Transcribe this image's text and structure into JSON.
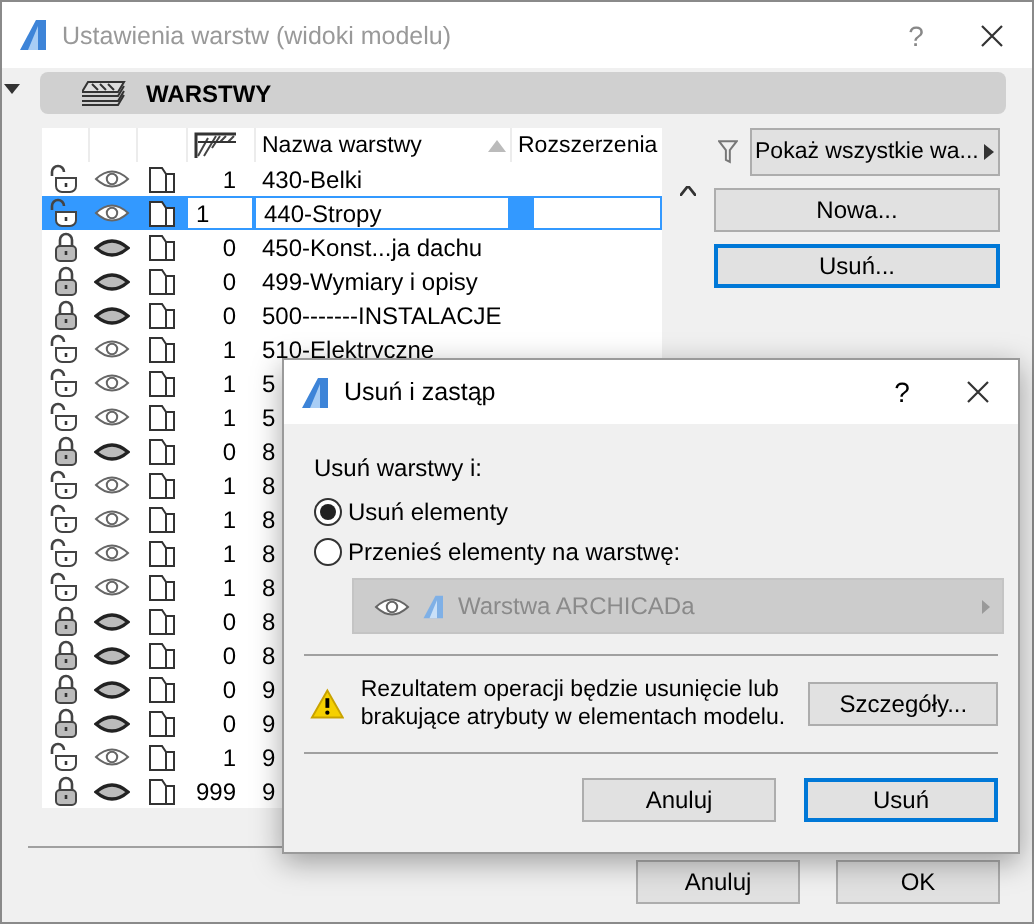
{
  "window": {
    "title": "Ustawienia warstw (widoki modelu)",
    "help": "?"
  },
  "header": {
    "title": "WARSTWY"
  },
  "table": {
    "columns": [
      {
        "label": "Nazwa warstwy",
        "sorted": true
      },
      {
        "label": "Rozszerzenia"
      }
    ],
    "rows": [
      {
        "locked": false,
        "visible": true,
        "number": "1",
        "name": "430-Belki",
        "selected": false
      },
      {
        "locked": false,
        "visible": true,
        "number": "1",
        "name": "440-Stropy",
        "selected": true
      },
      {
        "locked": true,
        "visible": false,
        "number": "0",
        "name": "450-Konst...ja dachu",
        "selected": false
      },
      {
        "locked": true,
        "visible": false,
        "number": "0",
        "name": "499-Wymiary i opisy",
        "selected": false
      },
      {
        "locked": true,
        "visible": false,
        "number": "0",
        "name": "500-------INSTALACJE",
        "selected": false
      },
      {
        "locked": false,
        "visible": true,
        "number": "1",
        "name": "510-Elektryczne",
        "selected": false
      },
      {
        "locked": false,
        "visible": true,
        "number": "1",
        "name": "5",
        "selected": false
      },
      {
        "locked": false,
        "visible": true,
        "number": "1",
        "name": "5",
        "selected": false
      },
      {
        "locked": true,
        "visible": false,
        "number": "0",
        "name": "8",
        "selected": false
      },
      {
        "locked": false,
        "visible": true,
        "number": "1",
        "name": "8",
        "selected": false
      },
      {
        "locked": false,
        "visible": true,
        "number": "1",
        "name": "8",
        "selected": false
      },
      {
        "locked": false,
        "visible": true,
        "number": "1",
        "name": "8",
        "selected": false
      },
      {
        "locked": false,
        "visible": true,
        "number": "1",
        "name": "8",
        "selected": false
      },
      {
        "locked": true,
        "visible": false,
        "number": "0",
        "name": "8",
        "selected": false
      },
      {
        "locked": true,
        "visible": false,
        "number": "0",
        "name": "8",
        "selected": false
      },
      {
        "locked": true,
        "visible": false,
        "number": "0",
        "name": "9",
        "selected": false
      },
      {
        "locked": true,
        "visible": false,
        "number": "0",
        "name": "9",
        "selected": false
      },
      {
        "locked": false,
        "visible": true,
        "number": "1",
        "name": "9",
        "selected": false
      },
      {
        "locked": true,
        "visible": false,
        "number": "999",
        "name": "9",
        "selected": false
      }
    ]
  },
  "filter": {
    "label": "Pokaż wszystkie wa..."
  },
  "side_buttons": [
    {
      "label": "Nowa...",
      "focused": false
    },
    {
      "label": "Usuń...",
      "focused": true
    }
  ],
  "footer_buttons": [
    {
      "label": "Anuluj"
    },
    {
      "label": "OK"
    }
  ],
  "dialog": {
    "title": "Usuń i zastąp",
    "help": "?",
    "prompt": "Usuń warstwy i:",
    "options": [
      {
        "label": "Usuń elementy",
        "selected": true
      },
      {
        "label": "Przenieś elementy na warstwę:",
        "selected": false
      }
    ],
    "layer_select": {
      "value": "Warstwa ARCHICADa",
      "disabled": true
    },
    "warning": "Rezultatem operacji będzie usunięcie lub brakujące atrybuty w elementach modelu.",
    "details_button": "Szczegóły...",
    "buttons": [
      {
        "label": "Anuluj",
        "focused": false
      },
      {
        "label": "Usuń",
        "focused": true
      }
    ]
  }
}
